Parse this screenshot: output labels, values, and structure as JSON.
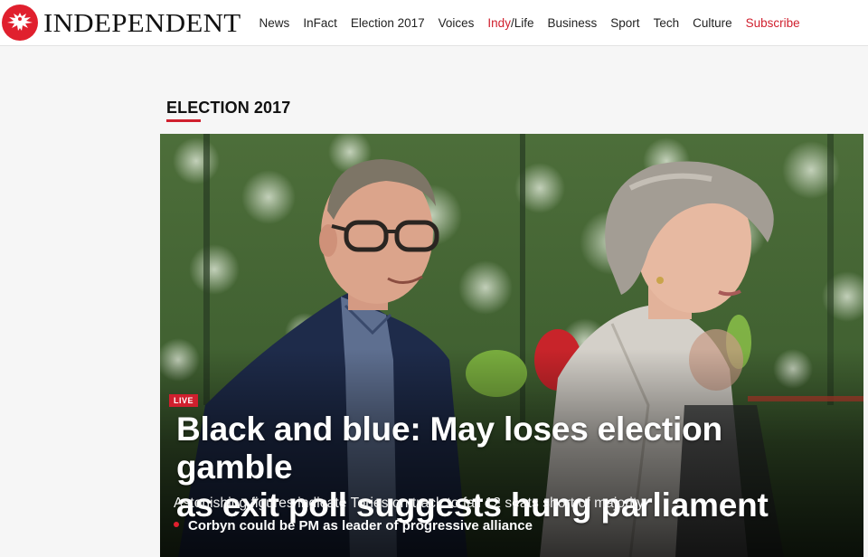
{
  "brand": {
    "name": "INDEPENDENT",
    "logo_icon": "eagle-icon",
    "accent_color": "#d0202e"
  },
  "nav": {
    "items": [
      {
        "label": "News"
      },
      {
        "label": "InFact"
      },
      {
        "label": "Election 2017"
      },
      {
        "label": "Voices"
      },
      {
        "label_indy": "Indy",
        "label_slash": "/",
        "label_life": "Life"
      },
      {
        "label": "Business"
      },
      {
        "label": "Sport"
      },
      {
        "label": "Tech"
      },
      {
        "label": "Culture"
      },
      {
        "label": "Subscribe"
      }
    ]
  },
  "section": {
    "title": "ELECTION 2017"
  },
  "hero": {
    "badge": "LIVE",
    "headline_line1": "Black and blue: May loses election gamble",
    "headline_line2": "as exit poll suggests hung parliament",
    "standfirst": "Astonishing figures indicate Tories on track to fall 12 seats short of majority",
    "related_link": "Corbyn could be PM as leader of progressive alliance"
  }
}
